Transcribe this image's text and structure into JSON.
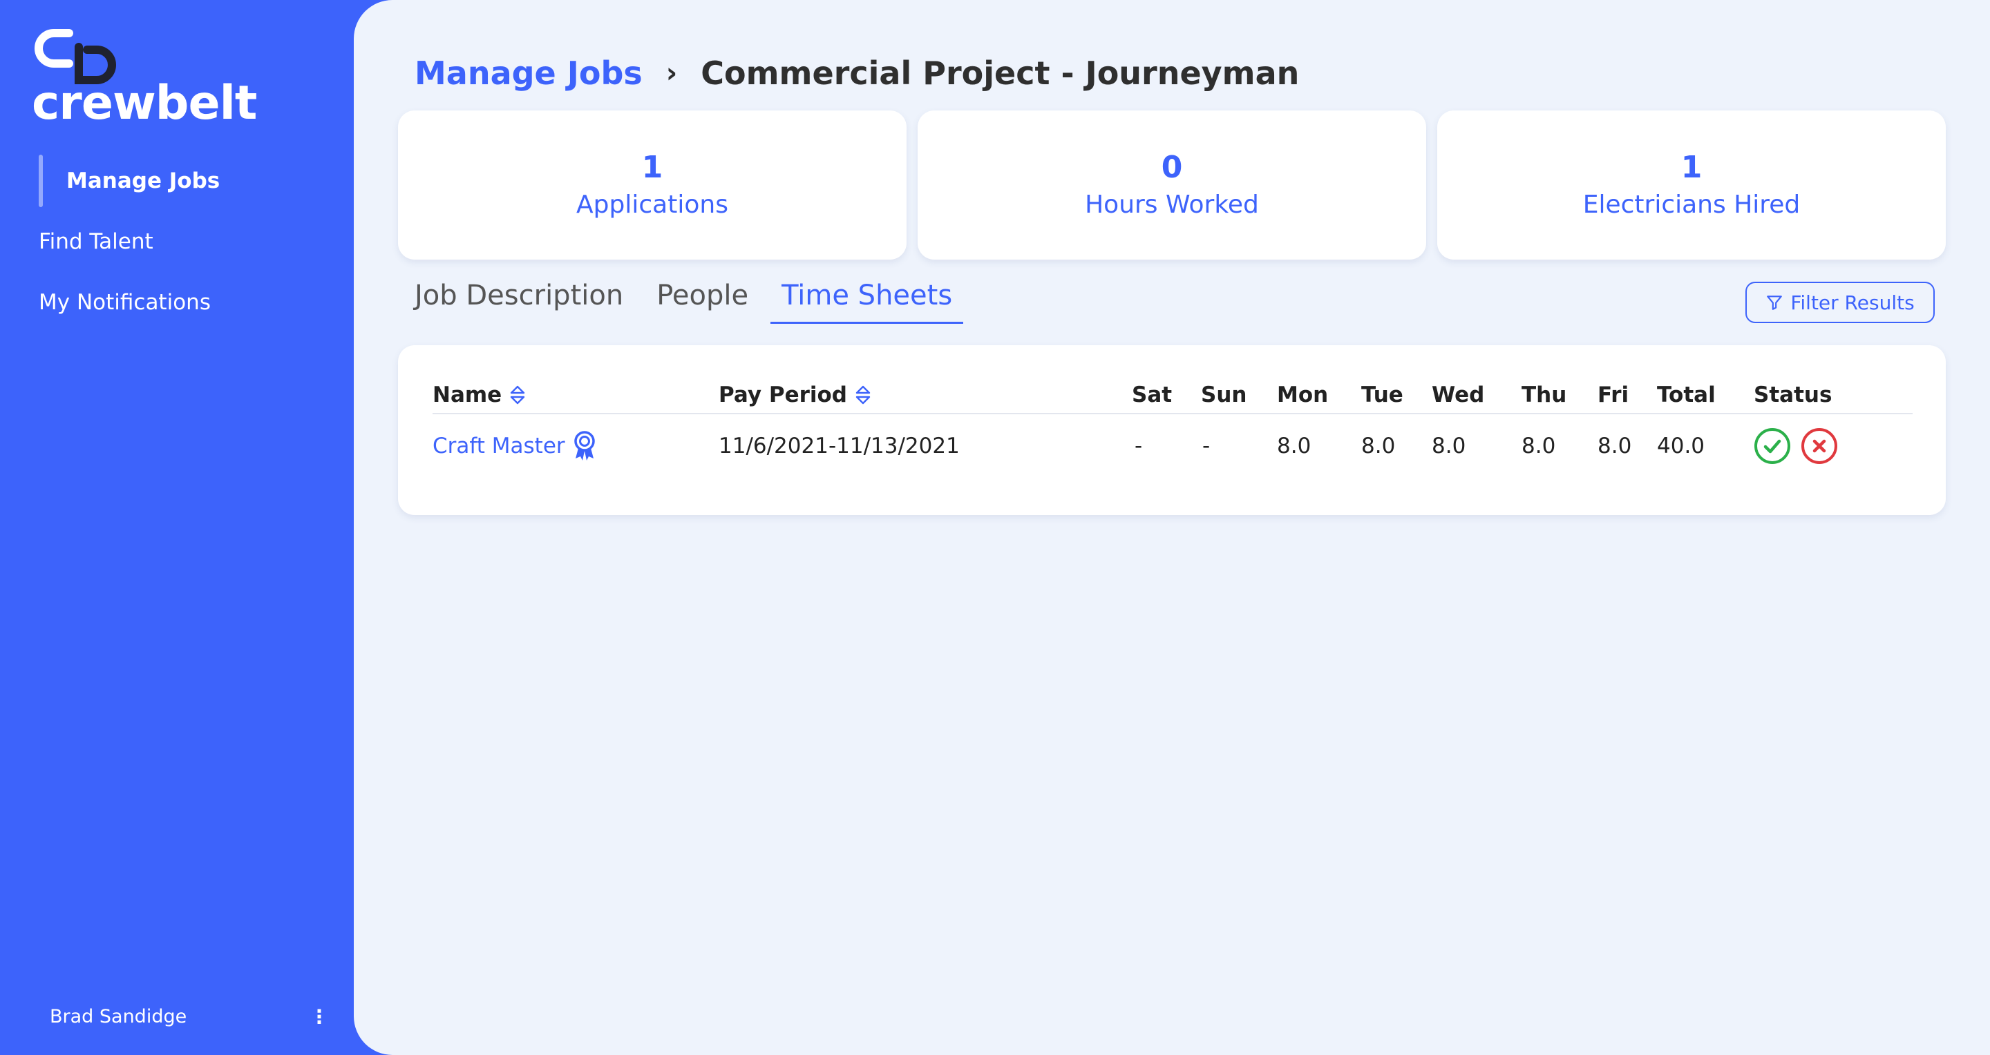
{
  "app": {
    "brand": "crewbelt"
  },
  "sidebar": {
    "items": [
      {
        "label": "Manage Jobs"
      },
      {
        "label": "Find Talent"
      },
      {
        "label": "My Notifications"
      }
    ],
    "user_name": "Brad Sandidge",
    "menu_glyph": "⋮"
  },
  "breadcrumb": {
    "parent": "Manage Jobs",
    "separator": "›",
    "current": "Commercial Project - Journeyman"
  },
  "stats": [
    {
      "value": "1",
      "label": "Applications"
    },
    {
      "value": "0",
      "label": "Hours Worked"
    },
    {
      "value": "1",
      "label": "Electricians Hired"
    }
  ],
  "tabs": [
    {
      "label": "Job Description"
    },
    {
      "label": "People"
    },
    {
      "label": "Time Sheets"
    }
  ],
  "filter": {
    "label": "Filter Results",
    "icon": "filter-icon"
  },
  "table": {
    "headers": {
      "name": "Name",
      "pay_period": "Pay Period",
      "sat": "Sat",
      "sun": "Sun",
      "mon": "Mon",
      "tue": "Tue",
      "wed": "Wed",
      "thu": "Thu",
      "fri": "Fri",
      "total": "Total",
      "status": "Status"
    },
    "rows": [
      {
        "name": "Craft Master",
        "pay_period": "11/6/2021-11/13/2021",
        "sat": "-",
        "sun": "-",
        "mon": "8.0",
        "tue": "8.0",
        "wed": "8.0",
        "thu": "8.0",
        "fri": "8.0",
        "total": "40.0"
      }
    ]
  },
  "colors": {
    "accent": "#3d63fb",
    "approve": "#2bb04a",
    "reject": "#e0393e",
    "background": "#eef3fc"
  }
}
